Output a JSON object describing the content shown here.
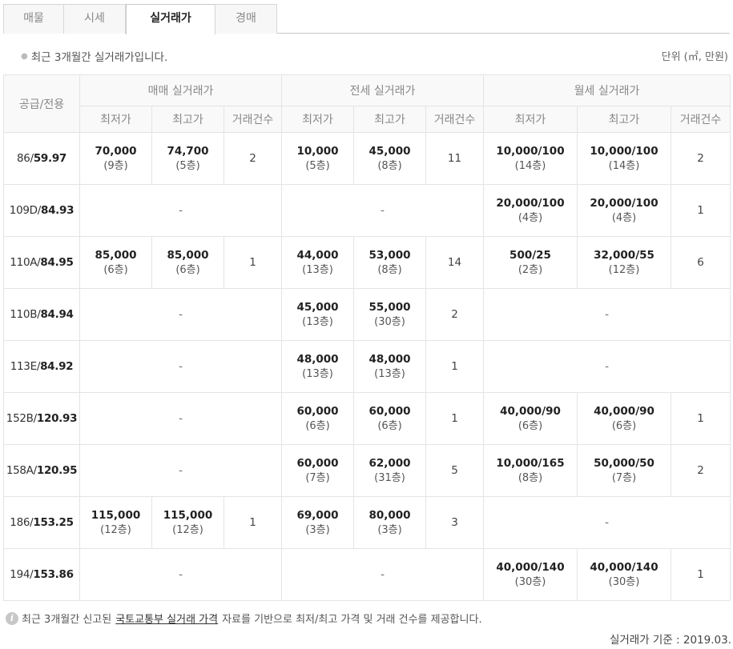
{
  "tabs": [
    {
      "label": "매물"
    },
    {
      "label": "시세"
    },
    {
      "label": "실거래가"
    },
    {
      "label": "경매"
    }
  ],
  "notice": "최근 3개월간 실거래가입니다.",
  "unit": "단위 (㎡, 만원)",
  "header": {
    "area": "공급/전용",
    "sale": "매매 실거래가",
    "jeonse": "전세 실거래가",
    "monthly": "월세 실거래가",
    "min": "최저가",
    "max": "최고가",
    "count": "거래건수"
  },
  "rows": [
    {
      "supply": "86",
      "exclusive": "59.97",
      "sale": {
        "min": "70,000",
        "min_floor": "(9층)",
        "max": "74,700",
        "max_floor": "(5층)",
        "count": "2"
      },
      "jeonse": {
        "min": "10,000",
        "min_floor": "(5층)",
        "max": "45,000",
        "max_floor": "(8층)",
        "count": "11"
      },
      "monthly": {
        "min": "10,000/100",
        "min_floor": "(14층)",
        "max": "10,000/100",
        "max_floor": "(14층)",
        "count": "2"
      }
    },
    {
      "supply": "109D",
      "exclusive": "84.93",
      "sale": {
        "none": "-"
      },
      "jeonse": {
        "none": "-"
      },
      "monthly": {
        "min": "20,000/100",
        "min_floor": "(4층)",
        "max": "20,000/100",
        "max_floor": "(4층)",
        "count": "1"
      }
    },
    {
      "supply": "110A",
      "exclusive": "84.95",
      "sale": {
        "min": "85,000",
        "min_floor": "(6층)",
        "max": "85,000",
        "max_floor": "(6층)",
        "count": "1"
      },
      "jeonse": {
        "min": "44,000",
        "min_floor": "(13층)",
        "max": "53,000",
        "max_floor": "(8층)",
        "count": "14"
      },
      "monthly": {
        "min": "500/25",
        "min_floor": "(2층)",
        "max": "32,000/55",
        "max_floor": "(12층)",
        "count": "6"
      }
    },
    {
      "supply": "110B",
      "exclusive": "84.94",
      "sale": {
        "none": "-"
      },
      "jeonse": {
        "min": "45,000",
        "min_floor": "(13층)",
        "max": "55,000",
        "max_floor": "(30층)",
        "count": "2"
      },
      "monthly": {
        "none": "-"
      }
    },
    {
      "supply": "113E",
      "exclusive": "84.92",
      "sale": {
        "none": "-"
      },
      "jeonse": {
        "min": "48,000",
        "min_floor": "(13층)",
        "max": "48,000",
        "max_floor": "(13층)",
        "count": "1"
      },
      "monthly": {
        "none": "-"
      }
    },
    {
      "supply": "152B",
      "exclusive": "120.93",
      "sale": {
        "none": "-"
      },
      "jeonse": {
        "min": "60,000",
        "min_floor": "(6층)",
        "max": "60,000",
        "max_floor": "(6층)",
        "count": "1"
      },
      "monthly": {
        "min": "40,000/90",
        "min_floor": "(6층)",
        "max": "40,000/90",
        "max_floor": "(6층)",
        "count": "1"
      }
    },
    {
      "supply": "158A",
      "exclusive": "120.95",
      "sale": {
        "none": "-"
      },
      "jeonse": {
        "min": "60,000",
        "min_floor": "(7층)",
        "max": "62,000",
        "max_floor": "(31층)",
        "count": "5"
      },
      "monthly": {
        "min": "10,000/165",
        "min_floor": "(8층)",
        "max": "50,000/50",
        "max_floor": "(7층)",
        "count": "2"
      }
    },
    {
      "supply": "186",
      "exclusive": "153.25",
      "sale": {
        "min": "115,000",
        "min_floor": "(12층)",
        "max": "115,000",
        "max_floor": "(12층)",
        "count": "1"
      },
      "jeonse": {
        "min": "69,000",
        "min_floor": "(3층)",
        "max": "80,000",
        "max_floor": "(3층)",
        "count": "3"
      },
      "monthly": {
        "none": "-"
      }
    },
    {
      "supply": "194",
      "exclusive": "153.86",
      "sale": {
        "none": "-"
      },
      "jeonse": {
        "none": "-"
      },
      "monthly": {
        "min": "40,000/140",
        "min_floor": "(30층)",
        "max": "40,000/140",
        "max_floor": "(30층)",
        "count": "1"
      }
    }
  ],
  "footer": {
    "prefix": "최근 3개월간 신고된",
    "link": "국토교통부 실거래 가격",
    "suffix": "자료를 기반으로 최저/최고 가격 및 거래 건수를 제공합니다.",
    "basis": "실거래가 기준 : 2019.03."
  }
}
